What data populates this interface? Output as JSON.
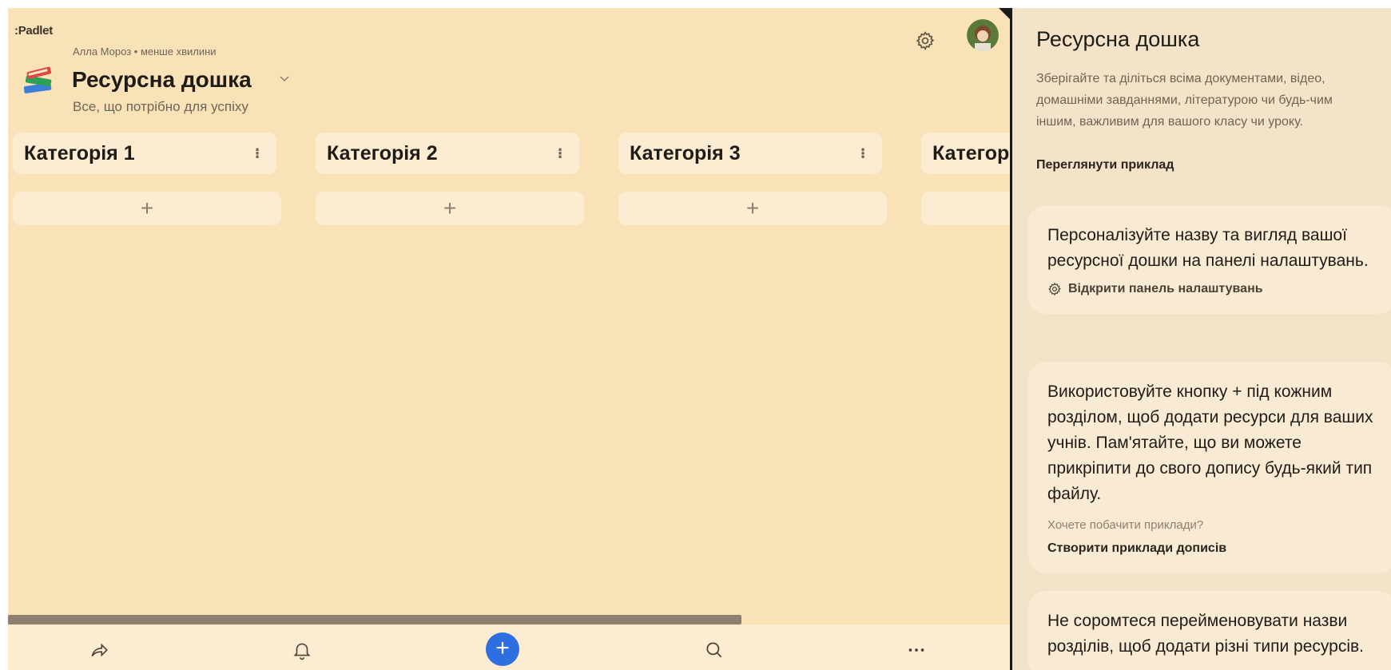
{
  "app": {
    "logo": ":Padlet"
  },
  "board": {
    "author": "Алла Мороз",
    "time": "менше хвилини",
    "title": "Ресурсна дошка",
    "description": "Все, що потрібно для успіху"
  },
  "sections": [
    {
      "title": "Категорія 1",
      "add_label": "+"
    },
    {
      "title": "Категорія 2",
      "add_label": "+"
    },
    {
      "title": "Категорія 3",
      "add_label": "+"
    },
    {
      "title": "Категор",
      "add_label": "+"
    }
  ],
  "bottom_bar": {
    "icons": [
      "share-icon",
      "bell-icon",
      "plus-icon",
      "search-icon",
      "more-icon"
    ],
    "accent": "#2d6ee0"
  },
  "panel": {
    "title": "Ресурсна дошка",
    "description": "Зберігайте та діліться всіма документами, відео, домашніми завданнями, літературою чи будь-чим іншим, важливим для вашого класу чи уроку.",
    "example_link": "Переглянути приклад",
    "cards": [
      {
        "text": "Персоналізуйте назву та вигляд вашої ресурсної дошки на панелі налаштувань.",
        "action": "Відкрити панель налаштувань"
      },
      {
        "text": "Використовуйте кнопку + під кожним розділом, щоб додати ресурси для ваших учнів. Пам'ятайте, що ви можете прикріпити до свого допису будь-який тип файлу.",
        "hint": "Хочете побачити приклади?",
        "link": "Створити приклади дописів"
      },
      {
        "text": "Не соромтеся перейменовувати назви розділів, щоб додати різні типи ресурсів."
      }
    ]
  },
  "colors": {
    "board_bg": "#f9e1b8",
    "section_bg": "#fcecd2",
    "panel_bg": "#f3e3c8",
    "card_bg": "#f9ebd3"
  }
}
